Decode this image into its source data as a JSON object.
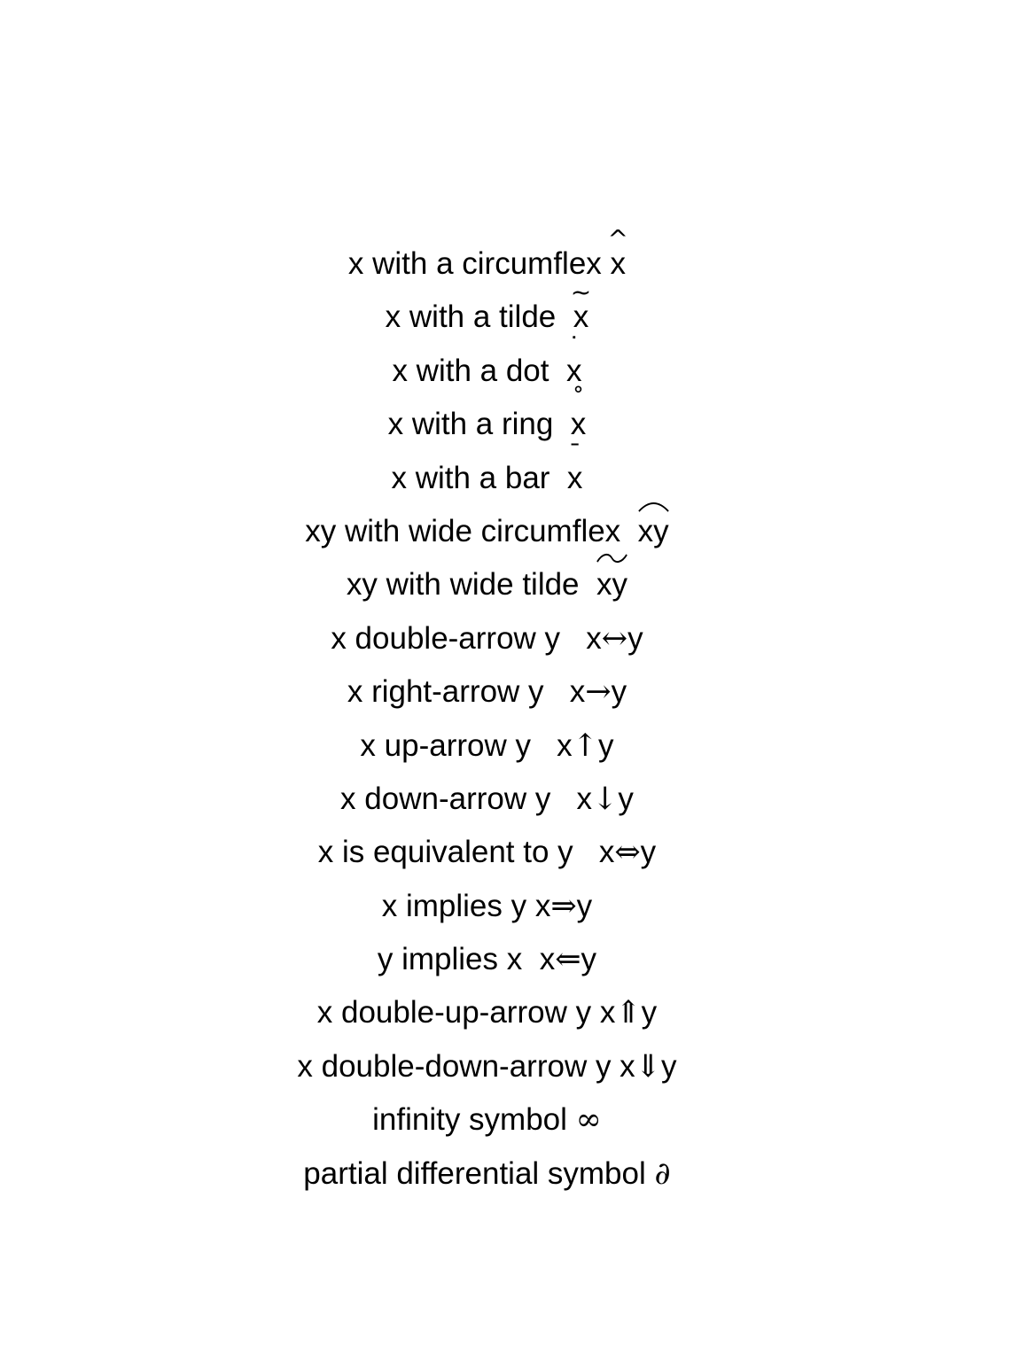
{
  "document": {
    "rows": [
      {
        "label": "x with a circumflex ",
        "base": "x",
        "accent": "^"
      },
      {
        "label": "x with a tilde  ",
        "base": "x",
        "accent": "~"
      },
      {
        "label": "x with a dot  ",
        "base": "x",
        "accent": "˙"
      },
      {
        "label": "x with a ring  ",
        "base": "x",
        "accent": "˚"
      },
      {
        "label": "x with a bar  ",
        "base": "x",
        "accent": "¯"
      },
      {
        "label": "xy with wide circumflex  ",
        "base": "xy"
      },
      {
        "label": "xy with wide tilde  ",
        "base": "xy"
      },
      {
        "label": "x double-arrow y   ",
        "left": "x",
        "symbol": "↔",
        "right": "y"
      },
      {
        "label": "x right-arrow y   ",
        "left": "x",
        "symbol": "→",
        "right": "y"
      },
      {
        "label": "x up-arrow y   ",
        "left": "x",
        "symbol": "↑",
        "right": "y"
      },
      {
        "label": "x down-arrow y   ",
        "left": "x",
        "symbol": "↓",
        "right": "y"
      },
      {
        "label": "x is equivalent to y   ",
        "left": "x",
        "symbol": "⇔",
        "right": "y"
      },
      {
        "label": "x implies y ",
        "left": "x",
        "symbol": "⇒",
        "right": "y"
      },
      {
        "label": "y implies x  ",
        "left": "x",
        "symbol": "⇐",
        "right": "y"
      },
      {
        "label": "x double-up-arrow y ",
        "left": "x",
        "symbol": "⇑",
        "right": "y"
      },
      {
        "label": "x double-down-arrow y ",
        "left": "x",
        "symbol": "⇓",
        "right": "y"
      },
      {
        "label": "infinity symbol ",
        "symbol": "∞"
      },
      {
        "label": "partial differential symbol ",
        "symbol": "∂"
      }
    ]
  }
}
